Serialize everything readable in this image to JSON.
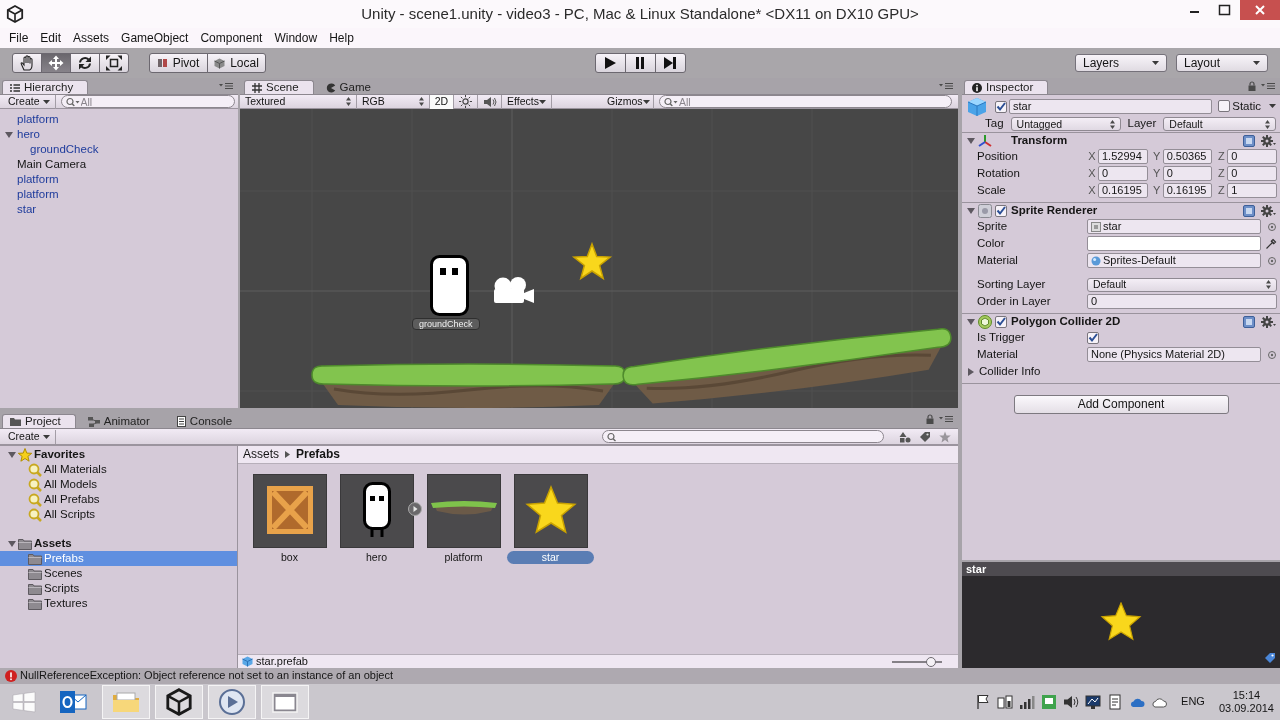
{
  "window": {
    "title": "Unity - scene1.unity - video3 - PC, Mac & Linux Standalone* <DX11 on DX10 GPU>"
  },
  "menu": [
    "File",
    "Edit",
    "Assets",
    "GameObject",
    "Component",
    "Window",
    "Help"
  ],
  "toolbar": {
    "tools": [
      {
        "kind": "hand",
        "selected": false
      },
      {
        "kind": "move",
        "selected": true
      },
      {
        "kind": "rotate",
        "selected": false
      },
      {
        "kind": "scale",
        "selected": false
      }
    ],
    "pivot": "Pivot",
    "space": "Local",
    "layers": "Layers",
    "layout": "Layout"
  },
  "hierarchy": {
    "tabs": [
      {
        "label": "Hierarchy",
        "kind": "hierarchy",
        "selected": true
      }
    ],
    "create": "Create",
    "search_placeholder": "All",
    "items": [
      {
        "label": "platform",
        "kind": "prefab"
      },
      {
        "label": "hero",
        "kind": "prefab",
        "expanded": true,
        "children": [
          {
            "label": "groundCheck",
            "kind": "prefab"
          }
        ]
      },
      {
        "label": "Main Camera",
        "kind": "object"
      },
      {
        "label": "platform",
        "kind": "prefab"
      },
      {
        "label": "platform",
        "kind": "prefab"
      },
      {
        "label": "star",
        "kind": "prefab"
      }
    ]
  },
  "scene": {
    "tabs": [
      {
        "label": "Scene",
        "kind": "scene",
        "selected": true
      },
      {
        "label": "Game",
        "kind": "game",
        "selected": false
      }
    ],
    "shading": "Textured",
    "render_mode": "RGB",
    "mode_2d": {
      "label": "2D",
      "on": true
    },
    "lighting": {
      "on": false
    },
    "audio": {
      "on": false
    },
    "effects": "Effects",
    "gizmos": "Gizmos",
    "search_placeholder": "All",
    "gizmo_label": "groundCheck"
  },
  "inspector": {
    "tabs": [
      {
        "label": "Inspector",
        "kind": "inspector",
        "selected": true
      }
    ],
    "object": {
      "active": true,
      "name": "star",
      "static_label": "Static",
      "static": false,
      "tag_label": "Tag",
      "tag": "Untagged",
      "layer_label": "Layer",
      "layer": "Default"
    },
    "components": [
      {
        "kind": "transform",
        "title": "Transform",
        "expanded": true,
        "fields": [
          {
            "kind": "vector",
            "label": "Position",
            "values": [
              {
                "axis": "X",
                "value": "1.52994"
              },
              {
                "axis": "Y",
                "value": "0.50365"
              },
              {
                "axis": "Z",
                "value": "0"
              }
            ]
          },
          {
            "kind": "vector",
            "label": "Rotation",
            "values": [
              {
                "axis": "X",
                "value": "0"
              },
              {
                "axis": "Y",
                "value": "0"
              },
              {
                "axis": "Z",
                "value": "0"
              }
            ]
          },
          {
            "kind": "vector",
            "label": "Scale",
            "values": [
              {
                "axis": "X",
                "value": "0.16195"
              },
              {
                "axis": "Y",
                "value": "0.16195"
              },
              {
                "axis": "Z",
                "value": "1"
              }
            ]
          }
        ]
      },
      {
        "kind": "sprite_renderer",
        "title": "Sprite Renderer",
        "expanded": true,
        "enabled": true,
        "fields": [
          {
            "kind": "sprite",
            "label": "Sprite",
            "value": "star"
          },
          {
            "kind": "color",
            "label": "Color",
            "color": "#ffffff"
          },
          {
            "kind": "material",
            "label": "Material",
            "value": "Sprites-Default"
          },
          {
            "kind": "dropdown",
            "label": "Sorting Layer",
            "value": "Default"
          },
          {
            "kind": "number",
            "label": "Order in Layer",
            "value": "0"
          }
        ]
      },
      {
        "kind": "collider",
        "title": "Polygon Collider 2D",
        "expanded": true,
        "enabled": true,
        "fields": [
          {
            "kind": "toggle",
            "label": "Is Trigger",
            "checked": true
          },
          {
            "kind": "reference",
            "label": "Material",
            "value": "None (Physics Material 2D)"
          },
          {
            "kind": "foldout",
            "label": "Collider Info",
            "expanded": false
          }
        ]
      }
    ],
    "add_component": "Add Component"
  },
  "preview": {
    "title": "star"
  },
  "project": {
    "tabs": [
      {
        "label": "Project",
        "kind": "project",
        "selected": true
      },
      {
        "label": "Animator",
        "kind": "animator",
        "selected": false
      },
      {
        "label": "Console",
        "kind": "console",
        "selected": false
      }
    ],
    "create": "Create",
    "tree": [
      {
        "label": "Favorites",
        "kind": "favorites",
        "expanded": true,
        "selected": false,
        "children": [
          {
            "label": "All Materials",
            "kind": "search",
            "selected": false
          },
          {
            "label": "All Models",
            "kind": "search",
            "selected": false
          },
          {
            "label": "All Prefabs",
            "kind": "search",
            "selected": false
          },
          {
            "label": "All Scripts",
            "kind": "search",
            "selected": false
          }
        ]
      },
      {
        "label": "Assets",
        "kind": "folder",
        "expanded": true,
        "selected": false,
        "children": [
          {
            "label": "Prefabs",
            "kind": "folder",
            "selected": true
          },
          {
            "label": "Scenes",
            "kind": "folder",
            "selected": false
          },
          {
            "label": "Scripts",
            "kind": "folder",
            "selected": false
          },
          {
            "label": "Textures",
            "kind": "folder",
            "selected": false
          }
        ]
      }
    ],
    "breadcrumb": [
      "Assets",
      "Prefabs"
    ],
    "assets": [
      {
        "label": "box",
        "kind": "box",
        "selected": false
      },
      {
        "label": "hero",
        "kind": "hero",
        "selected": false,
        "expanded": false
      },
      {
        "label": "platform",
        "kind": "platform",
        "selected": false
      },
      {
        "label": "star",
        "kind": "star",
        "selected": true
      }
    ],
    "selected_path": "star.prefab",
    "thumbnail_size": {
      "level": 0.78
    }
  },
  "status_bar": {
    "kind": "error",
    "message": "NullReferenceException: Object reference not set to an instance of an object"
  },
  "taskbar": {
    "apps": [
      {
        "kind": "mail",
        "running": false
      },
      {
        "kind": "explorer",
        "running": true
      },
      {
        "kind": "unity",
        "running": true
      },
      {
        "kind": "remote",
        "running": true
      },
      {
        "kind": "window",
        "running": true
      }
    ],
    "language": "ENG",
    "time": "15:14",
    "date": "03.09.2014"
  }
}
